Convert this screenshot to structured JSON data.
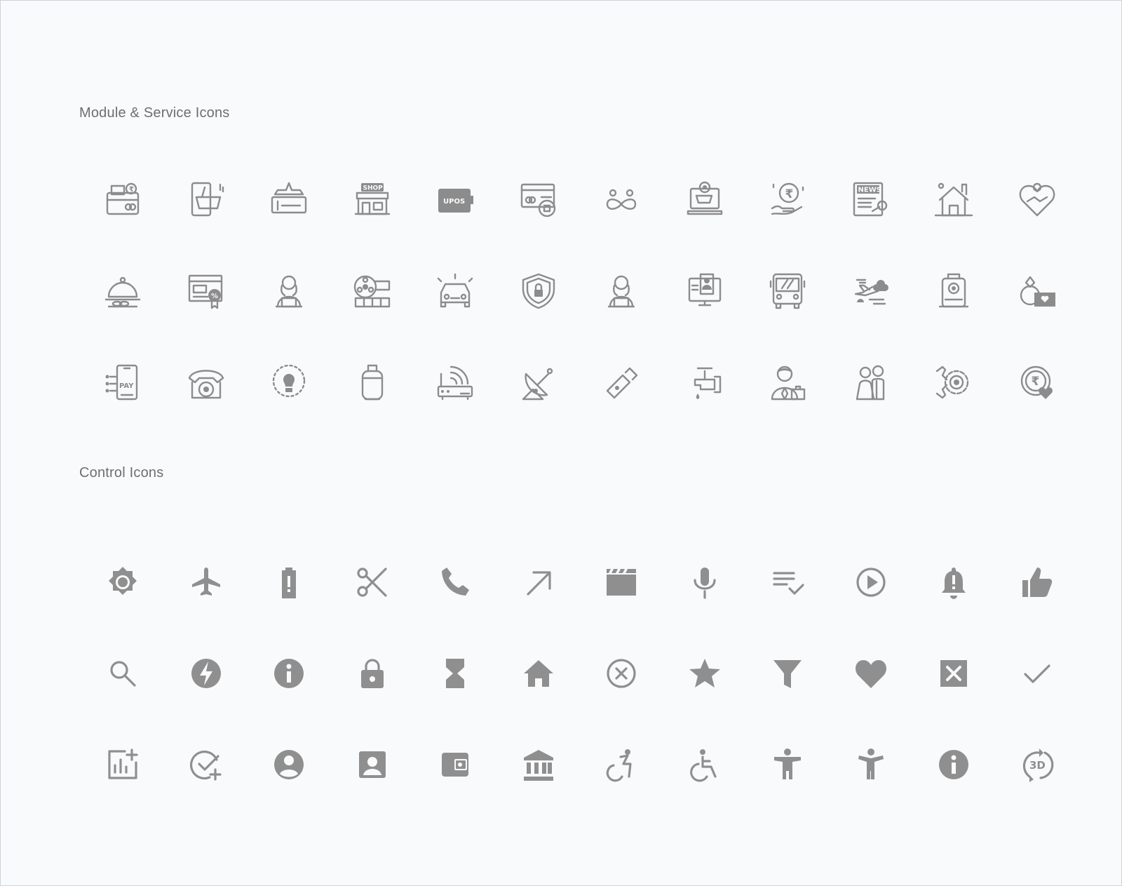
{
  "sections": {
    "module_title": "Module & Service Icons",
    "control_title": "Control Icons"
  },
  "icon_colors": {
    "module": "#8c8c8c",
    "control": "#8f8f8f",
    "background": "#f9fafc"
  },
  "module_icons": [
    "wallet-card-rupee-icon",
    "mobile-shopping-cart-icon",
    "flight-ticket-icon",
    "shop-icon",
    "upos-device-icon",
    "credit-card-security-icon",
    "infinity-people-icon",
    "laptop-shopping-cart-icon",
    "rupee-hand-icon",
    "newspaper-icon",
    "house-icon",
    "handshake-heart-icon",
    "food-cloche-icon",
    "discount-certificate-icon",
    "agent-woman-laptop-icon",
    "film-reel-icon",
    "car-icon",
    "security-shield-icon",
    "agent-woman-laptop-icon",
    "computer-profile-icon",
    "bus-icon",
    "airplane-clouds-icon",
    "train-icon",
    "ring-money-icon",
    "mobile-pay-icon",
    "telephone-icon",
    "bulb-icon",
    "gas-cylinder-icon",
    "router-icon",
    "satellite-dish-icon",
    "usb-stick-icon",
    "water-tap-icon",
    "businessman-icon",
    "couple-icon",
    "gear-wrench-icon",
    "rupee-heart-coin-icon"
  ],
  "module_labels": {
    "shop": "SHOP",
    "upos": "UPOS",
    "news": "NEWS",
    "pay": "PAY"
  },
  "control_icons": [
    "brightness-icon",
    "airplane-icon",
    "battery-alert-icon",
    "scissors-icon",
    "phone-icon",
    "arrow-up-right-icon",
    "clapperboard-icon",
    "microphone-icon",
    "playlist-check-icon",
    "play-circle-icon",
    "notification-alert-icon",
    "thumb-up-icon",
    "search-icon",
    "flash-circle-icon",
    "info-icon",
    "lock-icon",
    "hourglass-icon",
    "home-icon",
    "cancel-circle-icon",
    "star-icon",
    "filter-icon",
    "heart-icon",
    "close-box-icon",
    "check-icon",
    "add-chart-icon",
    "add-task-icon",
    "account-circle-icon",
    "contact-box-icon",
    "wallet-icon",
    "bank-icon",
    "accessible-forward-icon",
    "accessible-icon",
    "accessibility-icon",
    "accessibility-new-icon",
    "info-icon",
    "rotate-3d-icon"
  ],
  "control_labels": {
    "three_d": "3D"
  }
}
